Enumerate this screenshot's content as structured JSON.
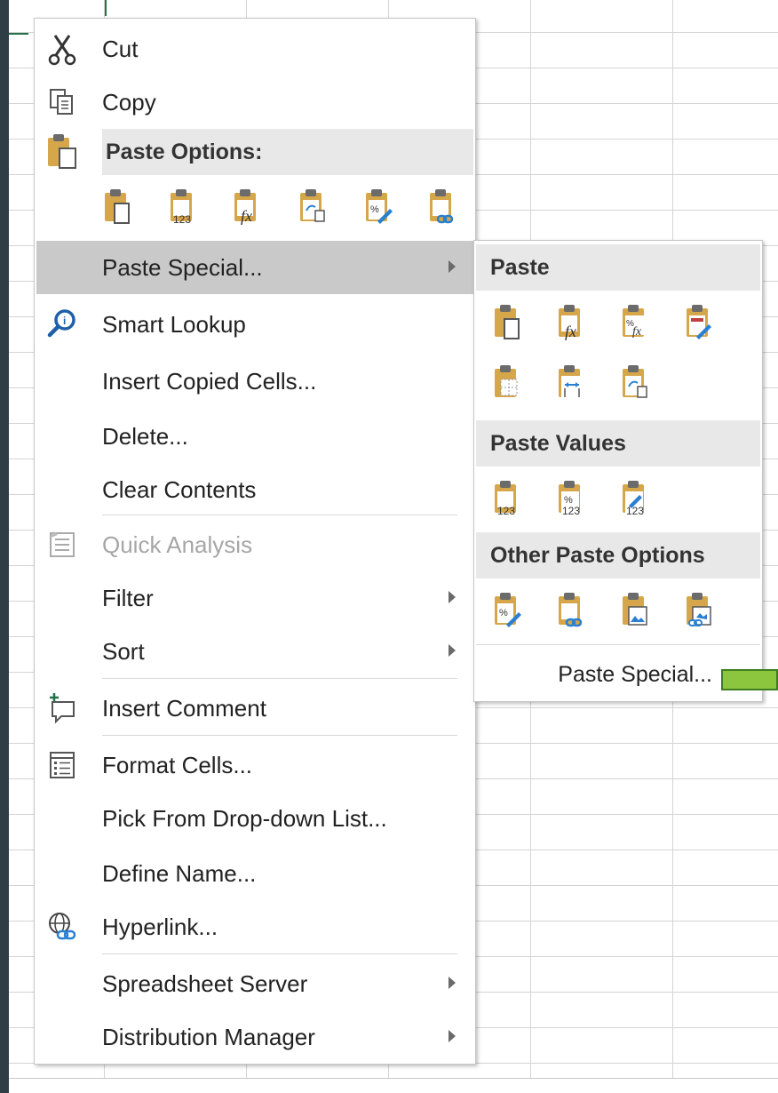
{
  "menu": {
    "cut": "Cut",
    "copy": "Copy",
    "paste_options_header": "Paste Options:",
    "paste_special": "Paste Special...",
    "smart_lookup": "Smart Lookup",
    "insert_copied_cells": "Insert Copied Cells...",
    "delete": "Delete...",
    "clear_contents": "Clear Contents",
    "quick_analysis": "Quick Analysis",
    "filter": "Filter",
    "sort": "Sort",
    "insert_comment": "Insert Comment",
    "format_cells": "Format Cells...",
    "pick_from_dropdown": "Pick From Drop-down List...",
    "define_name": "Define Name...",
    "hyperlink": "Hyperlink...",
    "spreadsheet_server": "Spreadsheet Server",
    "distribution_manager": "Distribution Manager"
  },
  "submenu": {
    "paste_header": "Paste",
    "paste_values_header": "Paste Values",
    "other_paste_options_header": "Other Paste Options",
    "paste_special_link": "Paste Special..."
  },
  "icons": {
    "paste_options": [
      "paste",
      "paste-values-123",
      "paste-formulas-fx",
      "paste-transpose",
      "paste-formatting",
      "paste-link"
    ],
    "paste_group": [
      "paste",
      "formulas-fx",
      "formulas-number-formatting",
      "keep-source-formatting",
      "no-borders",
      "keep-column-widths",
      "transpose"
    ],
    "values_group": [
      "values-123",
      "values-number-formatting",
      "values-source-formatting"
    ],
    "other_group": [
      "formatting",
      "paste-link",
      "picture",
      "linked-picture"
    ]
  },
  "colors": {
    "accent_green": "#8cc63f",
    "highlight": "#c9c9c9",
    "clipboard_tan": "#d6a64b"
  }
}
